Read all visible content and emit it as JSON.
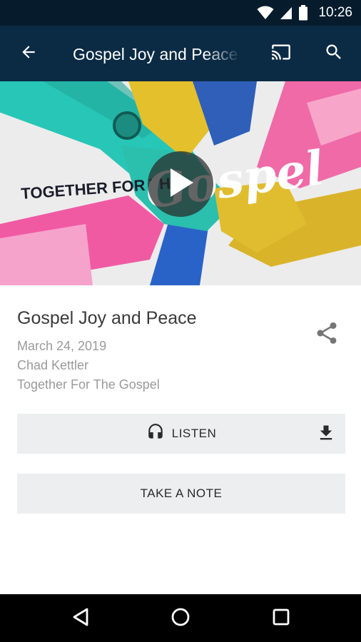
{
  "status_bar": {
    "time": "10:26",
    "icons": [
      "wifi-icon",
      "cellular-signal-icon",
      "battery-icon"
    ]
  },
  "app_bar": {
    "title": "Gospel Joy and Peace",
    "icons": [
      "back-arrow-icon",
      "cast-icon",
      "search-icon"
    ],
    "background_color": "#0b2b45"
  },
  "hero": {
    "artwork_text_left": "TOGETHER FOR THE",
    "artwork_text_script": "Gospel",
    "play_icon": "play-icon"
  },
  "episode": {
    "title": "Gospel Joy and Peace",
    "date": "March 24, 2019",
    "speaker": "Chad Kettler",
    "series": "Together For The Gospel",
    "share_icon": "share-icon"
  },
  "actions": {
    "listen_label": "LISTEN",
    "listen_icon": "headphones-icon",
    "download_icon": "download-icon",
    "note_label": "TAKE A NOTE"
  },
  "nav_bar": {
    "icons": [
      "nav-back-icon",
      "nav-home-icon",
      "nav-recents-icon"
    ]
  }
}
